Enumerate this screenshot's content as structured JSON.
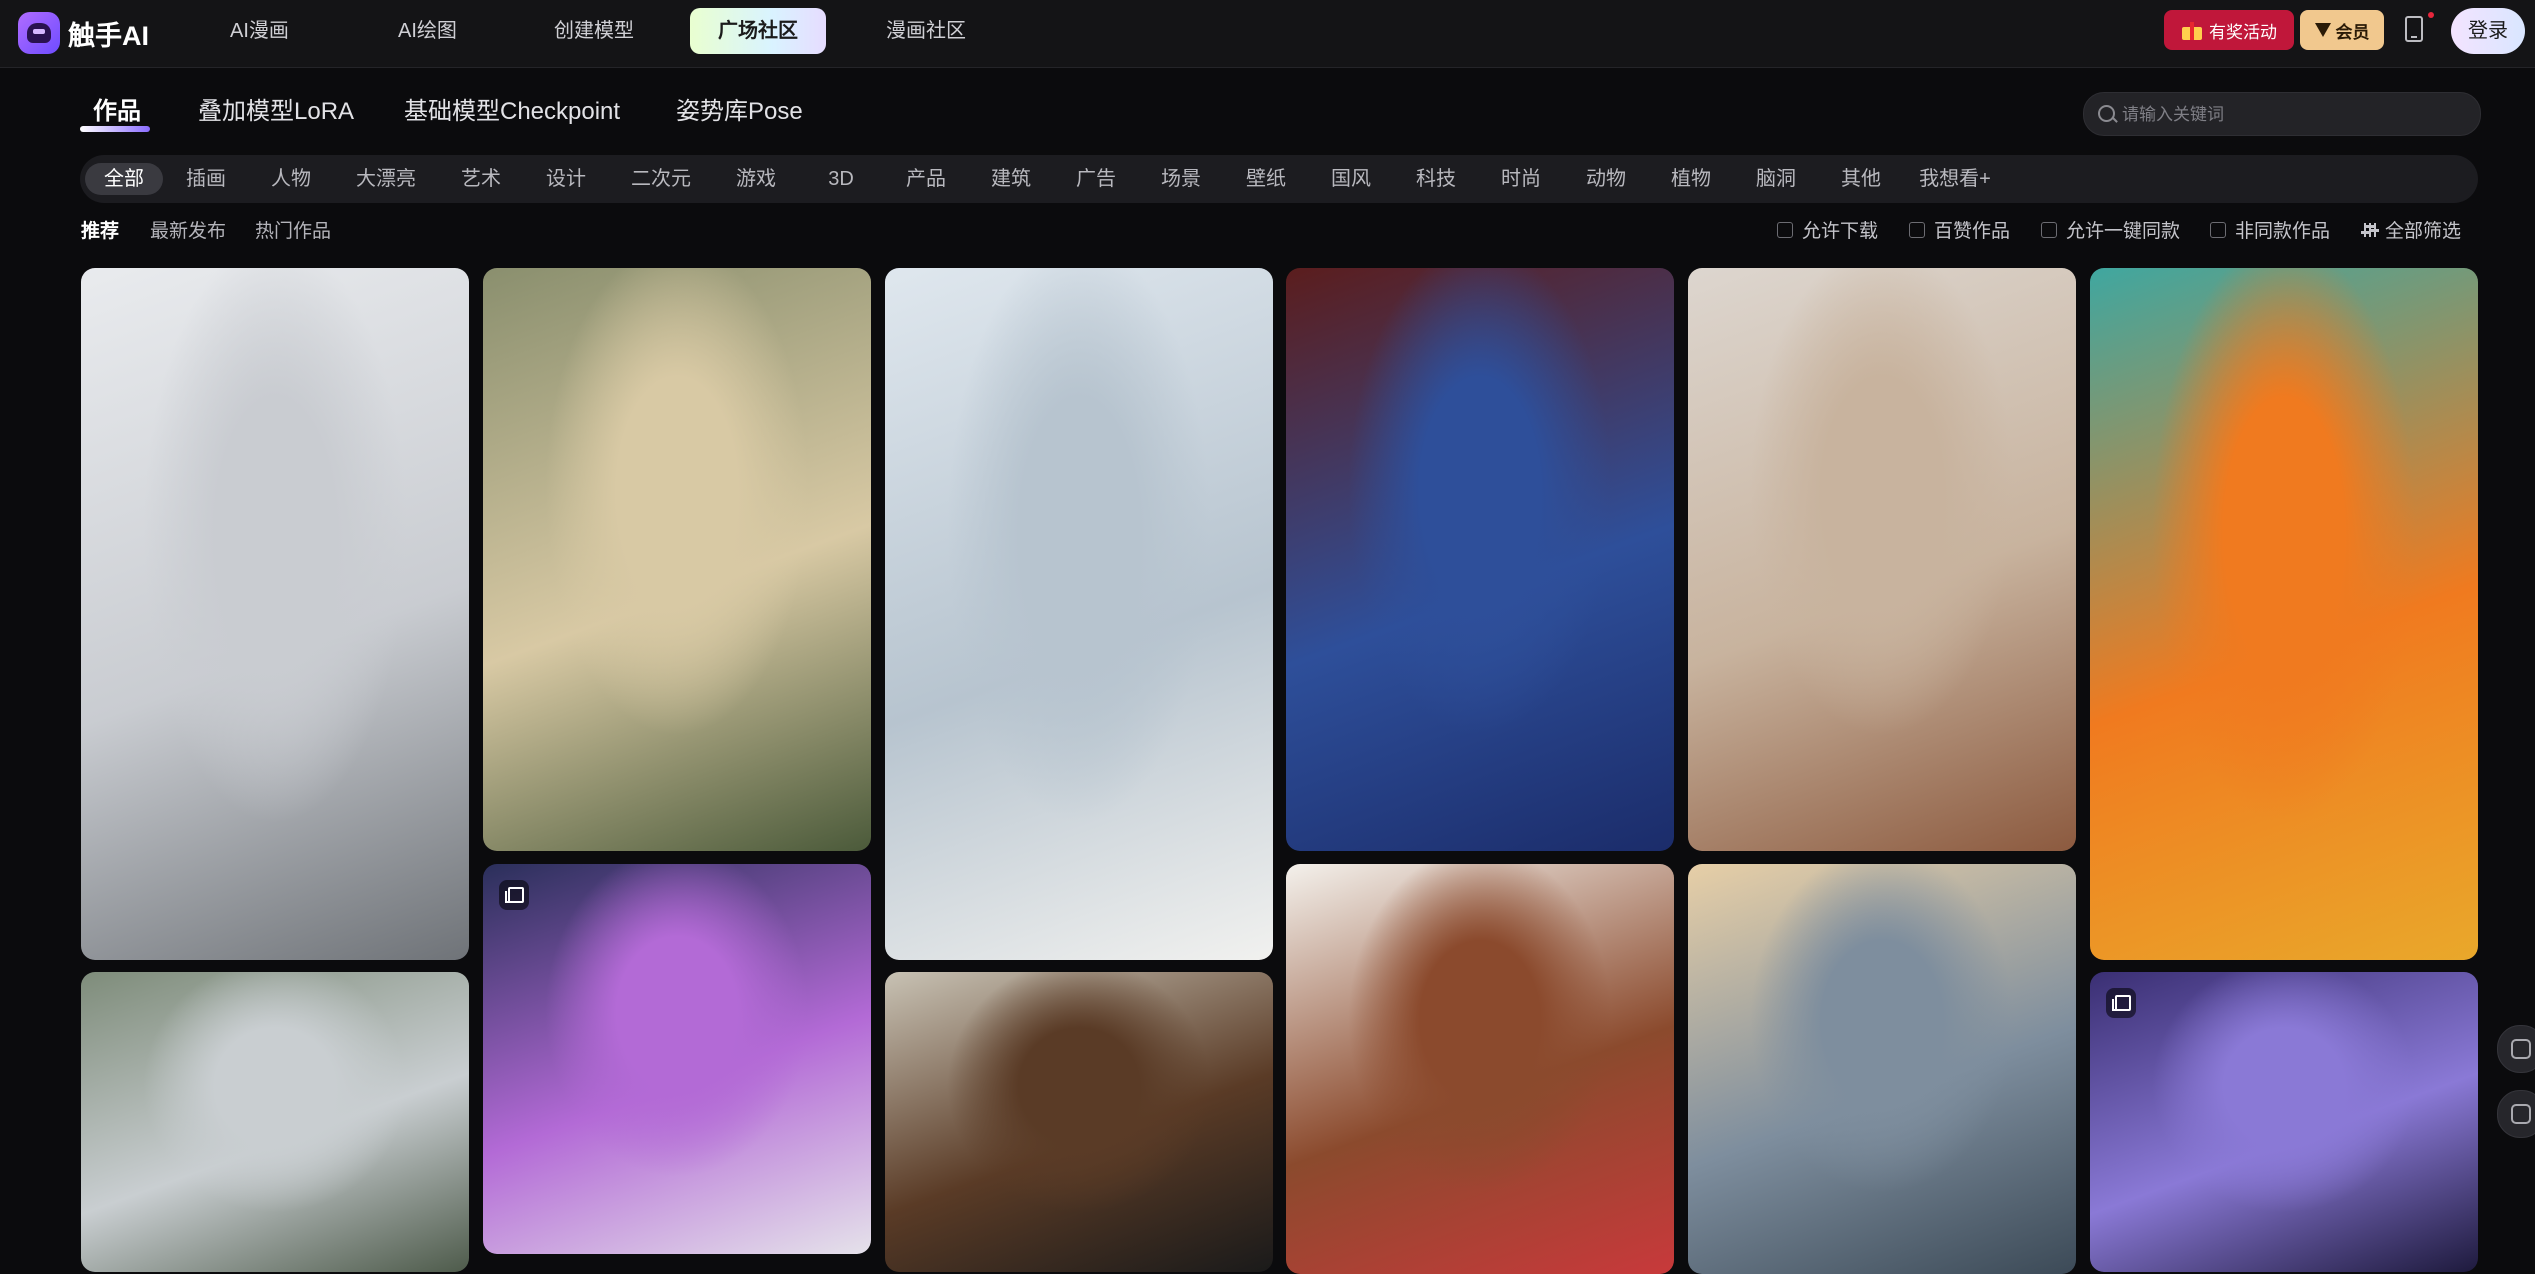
{
  "brand": {
    "name": "触手AI"
  },
  "nav": {
    "items": [
      {
        "label": "AI漫画"
      },
      {
        "label": "AI绘图"
      },
      {
        "label": "创建模型"
      },
      {
        "label": "广场社区",
        "active": true
      },
      {
        "label": "漫画社区"
      }
    ],
    "activity_label": "有奖活动",
    "vip_label": "会员",
    "login_label": "登录"
  },
  "content_tabs": [
    {
      "label": "作品",
      "active": true
    },
    {
      "label": "叠加模型LoRA"
    },
    {
      "label": "基础模型Checkpoint"
    },
    {
      "label": "姿势库Pose"
    }
  ],
  "search": {
    "placeholder": "请输入关键词"
  },
  "categories": [
    "全部",
    "插画",
    "人物",
    "大漂亮",
    "艺术",
    "设计",
    "二次元",
    "游戏",
    "3D",
    "产品",
    "建筑",
    "广告",
    "场景",
    "壁纸",
    "国风",
    "科技",
    "时尚",
    "动物",
    "植物",
    "脑洞",
    "其他",
    "我想看+"
  ],
  "sort_options": [
    {
      "label": "推荐",
      "active": true
    },
    {
      "label": "最新发布"
    },
    {
      "label": "热门作品"
    }
  ],
  "filters": {
    "allow_download": "允许下载",
    "most_liked": "百赞作品",
    "one_click_same": "允许一键同款",
    "non_same": "非同款作品",
    "all_filters": "全部筛选"
  },
  "gallery": {
    "cards": [
      {
        "subject": "anime-girl-coat",
        "colors": [
          "#e9ebee",
          "#c9ccd1",
          "#6f7378"
        ]
      },
      {
        "subject": "girl-with-roses",
        "colors": [
          "#8a8f6e",
          "#d8c9a4",
          "#4b5a3a"
        ]
      },
      {
        "subject": "office-kid-computer",
        "colors": [
          "#dfe7ee",
          "#b7c4cf",
          "#f1f1ef"
        ]
      },
      {
        "subject": "woman-blue-neon",
        "colors": [
          "#5b1d1d",
          "#2e4f9a",
          "#1b2c6a"
        ]
      },
      {
        "subject": "portrait-woman-sweater",
        "colors": [
          "#ddd6cf",
          "#c8b39e",
          "#8c5a3f"
        ]
      },
      {
        "subject": "pop-art-woman-flowers",
        "colors": [
          "#3fa7a0",
          "#f07a1f",
          "#e9a82b"
        ]
      },
      {
        "subject": "aerial-building",
        "colors": [
          "#7e8c7a",
          "#c9ced1",
          "#4e5b4b"
        ]
      },
      {
        "subject": "purple-hair-warrior",
        "colors": [
          "#2a2f5a",
          "#b36ad6",
          "#e5e2ea"
        ]
      },
      {
        "subject": "girl-at-door",
        "colors": [
          "#c8c2b4",
          "#5a3b26",
          "#1a1a1a"
        ]
      },
      {
        "subject": "anime-girl-uniform",
        "colors": [
          "#f4f1ec",
          "#8b4a2d",
          "#c8393b"
        ]
      },
      {
        "subject": "futuristic-city",
        "colors": [
          "#e7cfa7",
          "#7e8e9e",
          "#3c4a57"
        ]
      },
      {
        "subject": "purple-armor-moon",
        "colors": [
          "#3a2f73",
          "#8a79d6",
          "#1e1a3d"
        ]
      }
    ]
  }
}
